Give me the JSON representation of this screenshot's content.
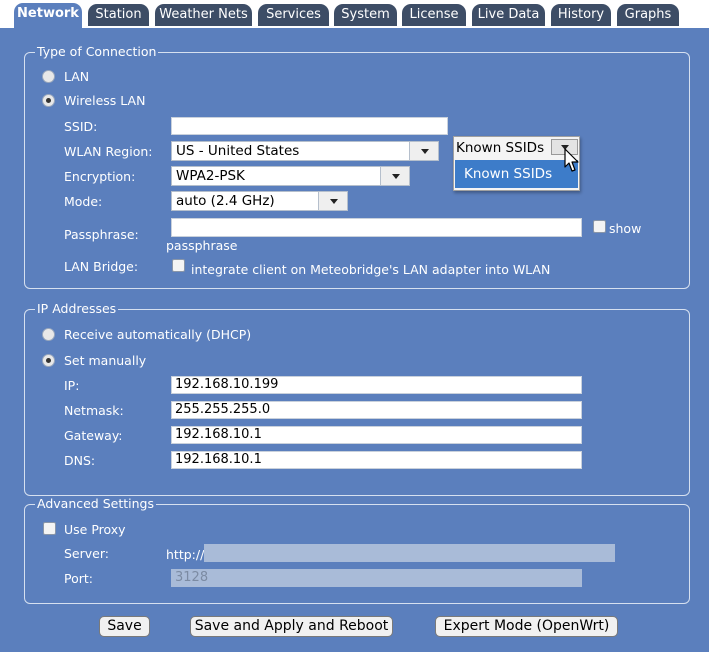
{
  "tabs": [
    "Network",
    "Station",
    "Weather Nets",
    "Services",
    "System",
    "License",
    "Live Data",
    "History",
    "Graphs"
  ],
  "connection": {
    "legend": "Type of Connection",
    "lan_label": "LAN",
    "wlan_label": "Wireless LAN",
    "selected": "Wireless LAN",
    "ssid_label": "SSID:",
    "ssid_value": "",
    "known_ssids_label": "Known SSIDs",
    "known_ssids_option": "Known SSIDs",
    "region_label": "WLAN Region:",
    "region_value": "US - United States",
    "encryption_label": "Encryption:",
    "encryption_value": "WPA2-PSK",
    "mode_label": "Mode:",
    "mode_value": "auto (2.4 GHz)",
    "passphrase_label": "Passphrase:",
    "passphrase_value": "",
    "show_label": "show",
    "passphrase_sub": "passphrase",
    "bridge_label": "LAN Bridge:",
    "bridge_text": "integrate client on Meteobridge's LAN adapter into WLAN"
  },
  "ip": {
    "legend": "IP Addresses",
    "dhcp_label": "Receive automatically (DHCP)",
    "manual_label": "Set manually",
    "selected": "Set manually",
    "ip_label": "IP:",
    "ip_value": "192.168.10.199",
    "netmask_label": "Netmask:",
    "netmask_value": "255.255.255.0",
    "gateway_label": "Gateway:",
    "gateway_value": "192.168.10.1",
    "dns_label": "DNS:",
    "dns_value": "192.168.10.1"
  },
  "advanced": {
    "legend": "Advanced Settings",
    "proxy_label": "Use Proxy",
    "server_label": "Server:",
    "server_prefix": "http://",
    "server_value": "",
    "port_label": "Port:",
    "port_placeholder": "3128"
  },
  "buttons": {
    "save": "Save",
    "save_reboot": "Save and Apply and Reboot",
    "expert": "Expert Mode (OpenWrt)"
  },
  "colors": {
    "background": "#5b7fbd",
    "tab_inactive": "#3d4d66",
    "dropdown_highlight": "#3d7cc9"
  }
}
